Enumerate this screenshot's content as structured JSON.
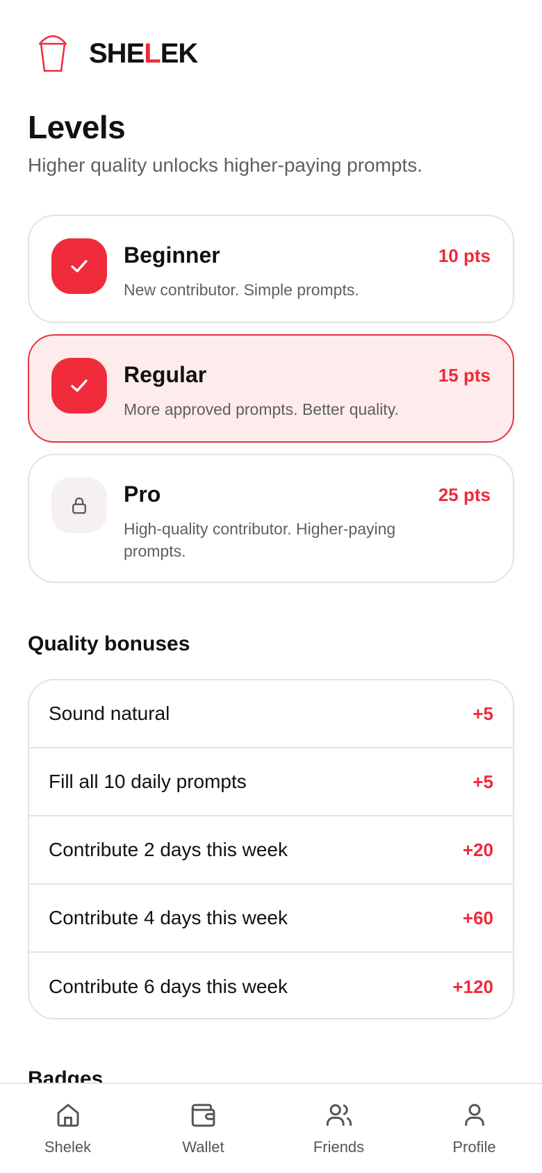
{
  "brand": {
    "name_part1": "SHE",
    "name_accent": "L",
    "name_part2": "EK",
    "accent_color": "#ee2a3a"
  },
  "header": {
    "title": "Levels",
    "subtitle": "Higher quality unlocks higher-paying prompts."
  },
  "levels": [
    {
      "name": "Beginner",
      "points": "10 pts",
      "description": "New contributor. Simple prompts.",
      "status": "completed",
      "icon": "check-icon"
    },
    {
      "name": "Regular",
      "points": "15 pts",
      "description": "More approved prompts. Better quality.",
      "status": "current",
      "icon": "check-icon"
    },
    {
      "name": "Pro",
      "points": "25 pts",
      "description": "High-quality contributor. Higher-paying prompts.",
      "status": "locked",
      "icon": "lock-icon"
    }
  ],
  "bonuses": {
    "title": "Quality bonuses",
    "items": [
      {
        "label": "Sound natural",
        "value": "+5"
      },
      {
        "label": "Fill all 10 daily prompts",
        "value": "+5"
      },
      {
        "label": "Contribute 2 days this week",
        "value": "+20"
      },
      {
        "label": "Contribute 4 days this week",
        "value": "+60"
      },
      {
        "label": "Contribute 6 days this week",
        "value": "+120"
      }
    ]
  },
  "badges": {
    "title": "Badges"
  },
  "nav": [
    {
      "label": "Shelek",
      "icon": "home-icon"
    },
    {
      "label": "Wallet",
      "icon": "wallet-icon"
    },
    {
      "label": "Friends",
      "icon": "friends-icon"
    },
    {
      "label": "Profile",
      "icon": "profile-icon"
    }
  ]
}
